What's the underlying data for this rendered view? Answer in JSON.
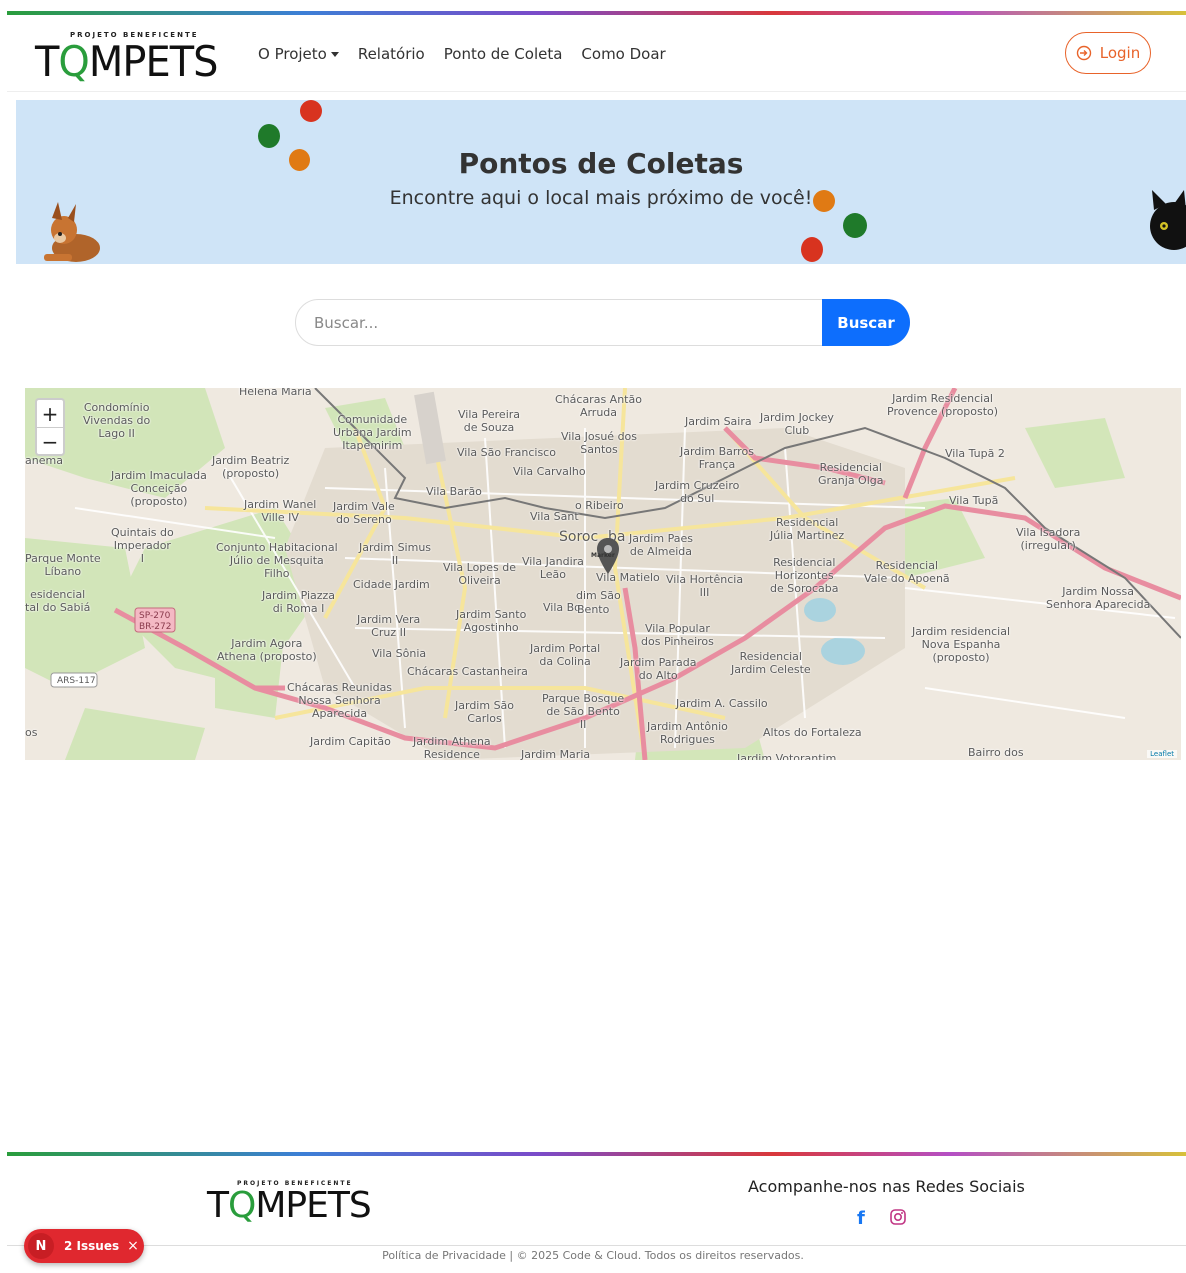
{
  "header": {
    "logo_sub": "PROJETO BENEFICENTE",
    "logo_text_a": "T",
    "logo_text_o": "Q",
    "logo_text_b": "MPETS",
    "nav": [
      "O Projeto",
      "Relatório",
      "Ponto de Coleta",
      "Como Doar"
    ],
    "login_label": "Login",
    "accent": "#e8632a"
  },
  "banner": {
    "title": "Pontos de Coletas",
    "subtitle": "Encontre aqui o local mais próximo de você!",
    "bg_color": "#cfe4f7"
  },
  "search": {
    "placeholder": "Buscar...",
    "button_label": "Buscar",
    "button_color": "#0d6efd"
  },
  "map": {
    "zoom_in": "+",
    "zoom_out": "−",
    "marker_label": "Marker",
    "attribution": "Leaflet",
    "labels": [
      "Helena Maria",
      "Condomínio Vivendas do Lago II",
      "Comunidade Urbana Jardim Itapemirim",
      "Vila Pereira de Souza",
      "Chácaras Antão Arruda",
      "Jardim Saira",
      "Jardim Jockey Club",
      "Jardim Residencial Provence (proposto)",
      "Vila Josué dos Santos",
      "Vila São Francisco",
      "Jardim Barros França",
      "Vila Carvalho",
      "Residencial Granja Olga",
      "Vila Tupã 2",
      "Jardim Beatriz (proposto)",
      "Jardim Imaculada Conceição (proposto)",
      "Vila Barão",
      "Jardim Cruzeiro do Sul",
      "Vila Tupã",
      "Jardim Wanel Ville IV",
      "Jardim Vale do Sereno",
      "Vila Sant",
      "o Ribeiro",
      "Residencial Júlia Martinez",
      "Vila Isadora (irregular)",
      "Quintais do Imperador I",
      "Conjunto Habitacional Júlio de Mesquita Filho",
      "Jardim Simus II",
      "Soroc",
      "ba",
      "Jardim Paes de Almeida",
      "Parque Monte Líbano",
      "Vila Lopes de Oliveira",
      "Vila Jandira Leão",
      "Vila Matielo",
      "Vila Hortência III",
      "Residencial Horizontes de Sorocaba",
      "Residencial Vale do Apoenã",
      "Cidade Jardim",
      "Jardim Nossa Senhora Aparecida",
      "esidencial tal do Sabiá",
      "Jardim Piazza di Roma I",
      "dim São",
      "Vila Bo",
      "Bento",
      "Jardim Santo Agostinho",
      "Jardim Vera Cruz II",
      "Vila Popular dos Pinheiros",
      "Jardim residencial Nova Espanha (proposto)",
      "Jardim Agora Athena (proposto)",
      "Vila Sônia",
      "Jardim Portal da Colina",
      "Jardim Parada do Alto",
      "Residencial Jardim Celeste",
      "Chácaras Castanheira",
      "Chácaras Reunidas Nossa Senhora Aparecida",
      "Parque Bosque de São Bento II",
      "Jardim A. Cassilo",
      "Jardim São Carlos",
      "Jardim Antônio Rodrigues",
      "Altos do Fortaleza",
      "Jardim Capitão",
      "Jardim Athena Residence",
      "Jardim Maria",
      "Bairro dos",
      "Jardim Votorantim",
      "SP-270",
      "BR-272",
      "ARS-117",
      "anema",
      "os"
    ]
  },
  "footer": {
    "social_title": "Acompanhe-nos nas Redes Sociais",
    "facebook_icon_text": "f",
    "copyright": "Política de Privacidade | © 2025 Code & Cloud. Todos os direitos reservados.",
    "issues_badge": "N",
    "issues_label": "2 Issues",
    "issues_close": "×"
  }
}
